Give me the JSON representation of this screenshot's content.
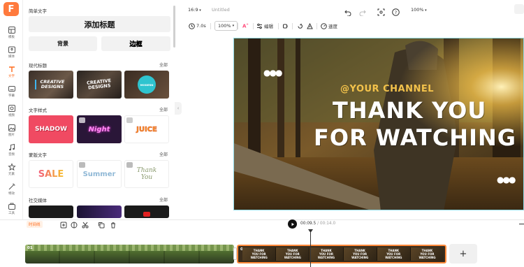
{
  "brand": {
    "logo_letter": "F",
    "accent": "#ff6a1a"
  },
  "rail": {
    "items": [
      {
        "label": "模板",
        "icon": "template-icon"
      },
      {
        "label": "媒体",
        "icon": "upload-icon"
      },
      {
        "label": "文字",
        "icon": "text-icon",
        "active": true
      },
      {
        "label": "字幕",
        "icon": "subtitle-icon"
      },
      {
        "label": "视频",
        "icon": "video-icon"
      },
      {
        "label": "图片",
        "icon": "image-icon"
      },
      {
        "label": "音频",
        "icon": "music-icon"
      },
      {
        "label": "元素",
        "icon": "elements-icon"
      },
      {
        "label": "特效",
        "icon": "effects-icon"
      },
      {
        "label": "工具",
        "icon": "tools-icon"
      }
    ]
  },
  "panel": {
    "simple_title": "简单文字",
    "add_title": "添加标题",
    "background": "背景",
    "border": "边框",
    "modern_title": "现代标题",
    "modern_all": "全部",
    "modern_cards": [
      "CREATIVE DESIGNS",
      "CREATIVE DESIGNS",
      "MODERN"
    ],
    "text_style_title": "文字样式",
    "text_style_all": "全部",
    "text_style_cards": [
      "SHADOW",
      "Night",
      "JUICE"
    ],
    "template_title": "蒙版文字",
    "template_all": "全部",
    "template_cards": [
      "SALE",
      "Summer",
      "Thank You"
    ],
    "social_title": "社交媒体",
    "social_all": "全部"
  },
  "topbar": {
    "aspect": "16:9",
    "doc_title": "Untitled",
    "zoom": "100%"
  },
  "toolbar": {
    "duration": "7.0s",
    "scale": "100%",
    "edit": "编辑",
    "speed": "速度"
  },
  "preview": {
    "channel": "@YOUR CHANNEL",
    "line1": "THANK YOU",
    "line2": "FOR WATCHING",
    "dots": "●●●"
  },
  "timeline": {
    "mode_label": "时间线",
    "current": "00:09.5",
    "total": "/ 00:14.0",
    "clip1_label": "01",
    "clip2_label": "02",
    "clip2_thumbs": [
      "THANK YOU FOR WATCHING",
      "THANK YOU FOR WATCHING",
      "THANK YOU FOR WATCHING",
      "THANK YOU FOR WATCHING",
      "THANK YOU FOR WATCHING",
      "THANK YOU FOR WATCHING"
    ],
    "add": "+"
  }
}
